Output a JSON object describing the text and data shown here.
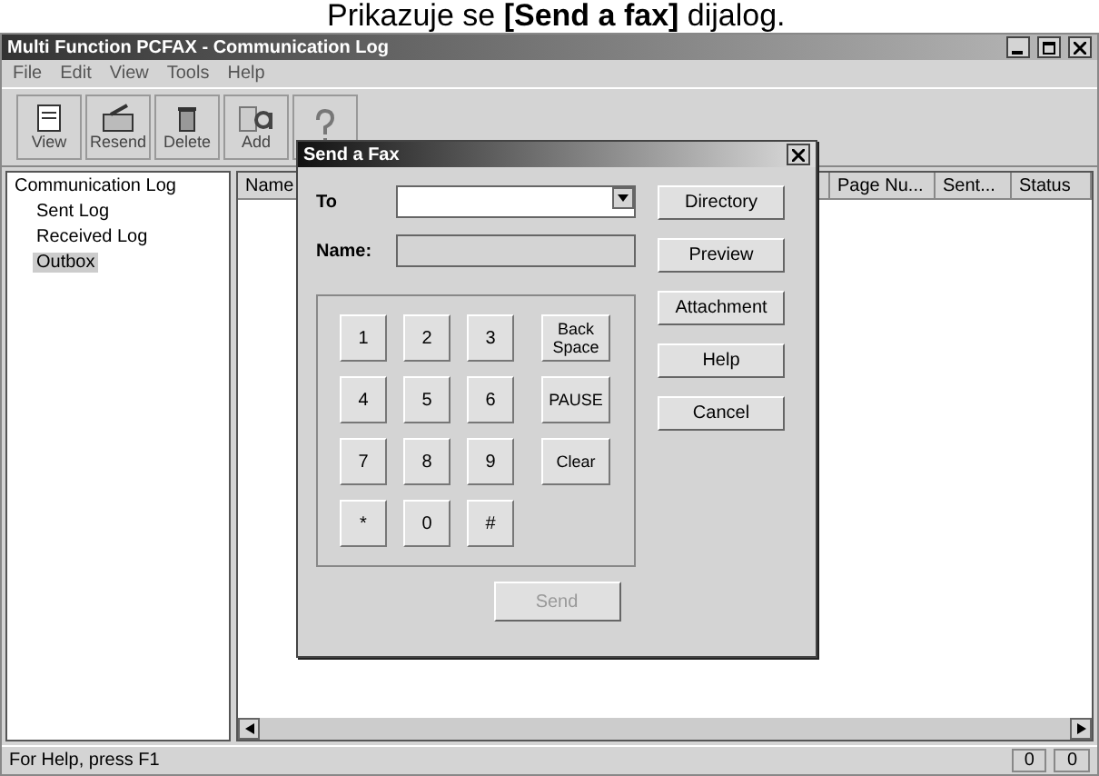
{
  "caption": "Prikazuje se **[Send a fax]** dijalog.",
  "window": {
    "title": "Multi Function PCFAX - Communication Log"
  },
  "menu": [
    "File",
    "Edit",
    "View",
    "Tools",
    "Help"
  ],
  "toolbar": [
    {
      "label": "View",
      "kind": "view"
    },
    {
      "label": "Resend",
      "kind": "resend"
    },
    {
      "label": "Delete",
      "kind": "delete"
    },
    {
      "label": "Add",
      "kind": "address"
    },
    {
      "kind": "help"
    }
  ],
  "tree": {
    "label": "Communication Log",
    "children": [
      {
        "label": "Sent Log",
        "selected": false
      },
      {
        "label": "Received Log",
        "selected": false
      },
      {
        "label": "Outbox",
        "selected": true
      }
    ]
  },
  "table": {
    "columns": [
      "Name",
      "Page Nu...",
      "Sent...",
      "Status"
    ]
  },
  "dialog": {
    "title": "Send a Fax",
    "to_label": "To",
    "name_label": "Name:",
    "keys": [
      {
        "label": "1",
        "kind": "digit"
      },
      {
        "label": "2",
        "kind": "digit"
      },
      {
        "label": "3",
        "kind": "digit"
      },
      {
        "label": "Back Space",
        "kind": "wide"
      },
      {
        "label": "4",
        "kind": "digit"
      },
      {
        "label": "5",
        "kind": "digit"
      },
      {
        "label": "6",
        "kind": "digit"
      },
      {
        "label": "PAUSE",
        "kind": "wide"
      },
      {
        "label": "7",
        "kind": "digit"
      },
      {
        "label": "8",
        "kind": "digit"
      },
      {
        "label": "9",
        "kind": "digit"
      },
      {
        "label": "Clear",
        "kind": "wide"
      },
      {
        "label": "*",
        "kind": "digit"
      },
      {
        "label": "0",
        "kind": "digit"
      },
      {
        "label": "#",
        "kind": "digit"
      }
    ],
    "side_buttons": [
      "Directory",
      "Preview",
      "Attachment",
      "Help",
      "Cancel"
    ],
    "send": {
      "label": "Send",
      "disabled": true
    }
  },
  "status_bar": {
    "text": "For Help, press F1",
    "cells": [
      "0",
      "0"
    ]
  }
}
